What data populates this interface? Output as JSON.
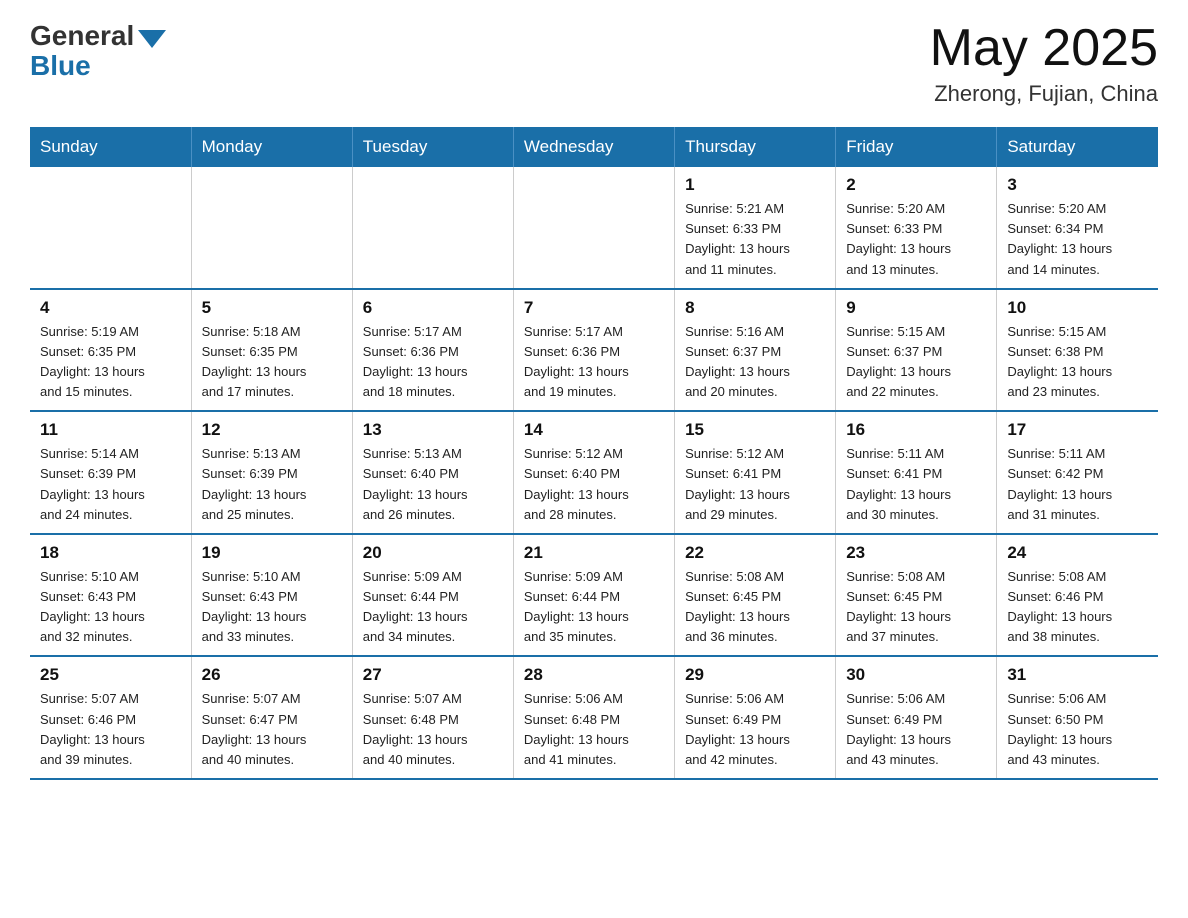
{
  "logo": {
    "general": "General",
    "blue": "Blue"
  },
  "header": {
    "title": "May 2025",
    "subtitle": "Zherong, Fujian, China"
  },
  "days_of_week": [
    "Sunday",
    "Monday",
    "Tuesday",
    "Wednesday",
    "Thursday",
    "Friday",
    "Saturday"
  ],
  "weeks": [
    [
      {
        "day": "",
        "info": ""
      },
      {
        "day": "",
        "info": ""
      },
      {
        "day": "",
        "info": ""
      },
      {
        "day": "",
        "info": ""
      },
      {
        "day": "1",
        "info": "Sunrise: 5:21 AM\nSunset: 6:33 PM\nDaylight: 13 hours\nand 11 minutes."
      },
      {
        "day": "2",
        "info": "Sunrise: 5:20 AM\nSunset: 6:33 PM\nDaylight: 13 hours\nand 13 minutes."
      },
      {
        "day": "3",
        "info": "Sunrise: 5:20 AM\nSunset: 6:34 PM\nDaylight: 13 hours\nand 14 minutes."
      }
    ],
    [
      {
        "day": "4",
        "info": "Sunrise: 5:19 AM\nSunset: 6:35 PM\nDaylight: 13 hours\nand 15 minutes."
      },
      {
        "day": "5",
        "info": "Sunrise: 5:18 AM\nSunset: 6:35 PM\nDaylight: 13 hours\nand 17 minutes."
      },
      {
        "day": "6",
        "info": "Sunrise: 5:17 AM\nSunset: 6:36 PM\nDaylight: 13 hours\nand 18 minutes."
      },
      {
        "day": "7",
        "info": "Sunrise: 5:17 AM\nSunset: 6:36 PM\nDaylight: 13 hours\nand 19 minutes."
      },
      {
        "day": "8",
        "info": "Sunrise: 5:16 AM\nSunset: 6:37 PM\nDaylight: 13 hours\nand 20 minutes."
      },
      {
        "day": "9",
        "info": "Sunrise: 5:15 AM\nSunset: 6:37 PM\nDaylight: 13 hours\nand 22 minutes."
      },
      {
        "day": "10",
        "info": "Sunrise: 5:15 AM\nSunset: 6:38 PM\nDaylight: 13 hours\nand 23 minutes."
      }
    ],
    [
      {
        "day": "11",
        "info": "Sunrise: 5:14 AM\nSunset: 6:39 PM\nDaylight: 13 hours\nand 24 minutes."
      },
      {
        "day": "12",
        "info": "Sunrise: 5:13 AM\nSunset: 6:39 PM\nDaylight: 13 hours\nand 25 minutes."
      },
      {
        "day": "13",
        "info": "Sunrise: 5:13 AM\nSunset: 6:40 PM\nDaylight: 13 hours\nand 26 minutes."
      },
      {
        "day": "14",
        "info": "Sunrise: 5:12 AM\nSunset: 6:40 PM\nDaylight: 13 hours\nand 28 minutes."
      },
      {
        "day": "15",
        "info": "Sunrise: 5:12 AM\nSunset: 6:41 PM\nDaylight: 13 hours\nand 29 minutes."
      },
      {
        "day": "16",
        "info": "Sunrise: 5:11 AM\nSunset: 6:41 PM\nDaylight: 13 hours\nand 30 minutes."
      },
      {
        "day": "17",
        "info": "Sunrise: 5:11 AM\nSunset: 6:42 PM\nDaylight: 13 hours\nand 31 minutes."
      }
    ],
    [
      {
        "day": "18",
        "info": "Sunrise: 5:10 AM\nSunset: 6:43 PM\nDaylight: 13 hours\nand 32 minutes."
      },
      {
        "day": "19",
        "info": "Sunrise: 5:10 AM\nSunset: 6:43 PM\nDaylight: 13 hours\nand 33 minutes."
      },
      {
        "day": "20",
        "info": "Sunrise: 5:09 AM\nSunset: 6:44 PM\nDaylight: 13 hours\nand 34 minutes."
      },
      {
        "day": "21",
        "info": "Sunrise: 5:09 AM\nSunset: 6:44 PM\nDaylight: 13 hours\nand 35 minutes."
      },
      {
        "day": "22",
        "info": "Sunrise: 5:08 AM\nSunset: 6:45 PM\nDaylight: 13 hours\nand 36 minutes."
      },
      {
        "day": "23",
        "info": "Sunrise: 5:08 AM\nSunset: 6:45 PM\nDaylight: 13 hours\nand 37 minutes."
      },
      {
        "day": "24",
        "info": "Sunrise: 5:08 AM\nSunset: 6:46 PM\nDaylight: 13 hours\nand 38 minutes."
      }
    ],
    [
      {
        "day": "25",
        "info": "Sunrise: 5:07 AM\nSunset: 6:46 PM\nDaylight: 13 hours\nand 39 minutes."
      },
      {
        "day": "26",
        "info": "Sunrise: 5:07 AM\nSunset: 6:47 PM\nDaylight: 13 hours\nand 40 minutes."
      },
      {
        "day": "27",
        "info": "Sunrise: 5:07 AM\nSunset: 6:48 PM\nDaylight: 13 hours\nand 40 minutes."
      },
      {
        "day": "28",
        "info": "Sunrise: 5:06 AM\nSunset: 6:48 PM\nDaylight: 13 hours\nand 41 minutes."
      },
      {
        "day": "29",
        "info": "Sunrise: 5:06 AM\nSunset: 6:49 PM\nDaylight: 13 hours\nand 42 minutes."
      },
      {
        "day": "30",
        "info": "Sunrise: 5:06 AM\nSunset: 6:49 PM\nDaylight: 13 hours\nand 43 minutes."
      },
      {
        "day": "31",
        "info": "Sunrise: 5:06 AM\nSunset: 6:50 PM\nDaylight: 13 hours\nand 43 minutes."
      }
    ]
  ]
}
